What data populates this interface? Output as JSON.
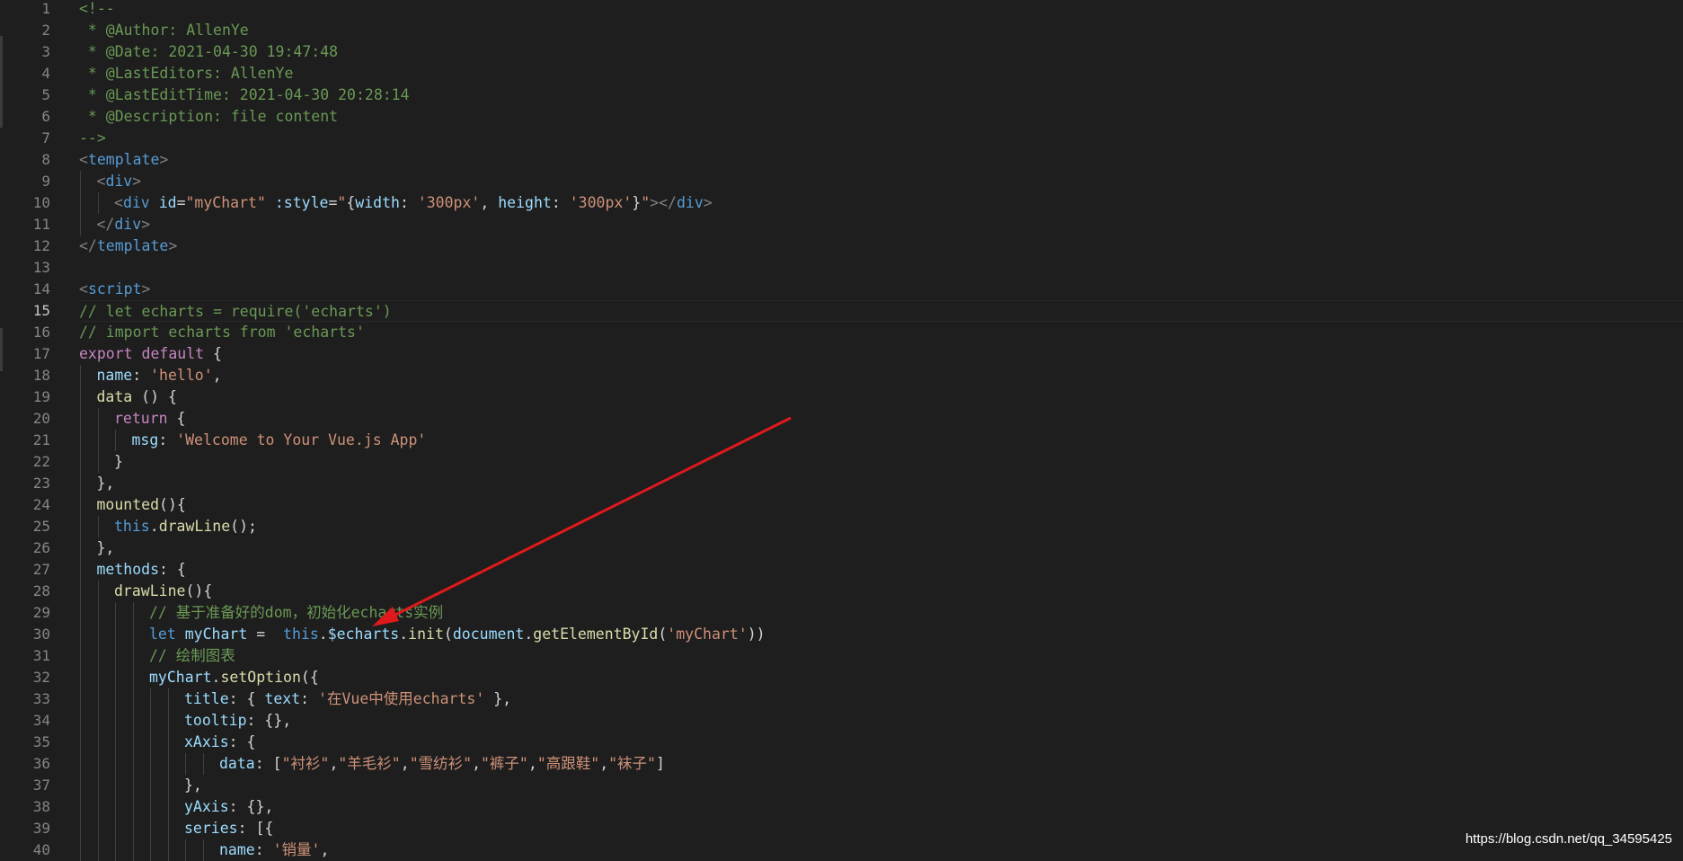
{
  "editor": {
    "active_line": 15,
    "colors": {
      "background": "#1e1e1e",
      "line_number": "#858585",
      "comment": "#6a9955",
      "tag": "#569cd6",
      "attribute": "#9cdcfe",
      "string": "#ce9178",
      "keyword": "#c586c0",
      "function": "#dcdcaa",
      "text": "#d4d4d4",
      "arrow": "#e0191b"
    },
    "lines": [
      {
        "n": "1",
        "indent": 0,
        "tokens": [
          {
            "t": "<!--",
            "c": "comment"
          }
        ]
      },
      {
        "n": "2",
        "indent": 0,
        "tokens": [
          {
            "t": " * @Author: AllenYe",
            "c": "comment"
          }
        ]
      },
      {
        "n": "3",
        "indent": 0,
        "tokens": [
          {
            "t": " * @Date: 2021-04-30 19:47:48",
            "c": "comment"
          }
        ]
      },
      {
        "n": "4",
        "indent": 0,
        "tokens": [
          {
            "t": " * @LastEditors: AllenYe",
            "c": "comment"
          }
        ]
      },
      {
        "n": "5",
        "indent": 0,
        "tokens": [
          {
            "t": " * @LastEditTime: 2021-04-30 20:28:14",
            "c": "comment"
          }
        ]
      },
      {
        "n": "6",
        "indent": 0,
        "tokens": [
          {
            "t": " * @Description: file content",
            "c": "comment"
          }
        ]
      },
      {
        "n": "7",
        "indent": 0,
        "tokens": [
          {
            "t": "-->",
            "c": "comment"
          }
        ]
      },
      {
        "n": "8",
        "indent": 0,
        "tokens": [
          {
            "t": "<",
            "c": "punct"
          },
          {
            "t": "template",
            "c": "tag"
          },
          {
            "t": ">",
            "c": "punct"
          }
        ]
      },
      {
        "n": "9",
        "indent": 1,
        "tokens": [
          {
            "t": "<",
            "c": "punct"
          },
          {
            "t": "div",
            "c": "tag"
          },
          {
            "t": ">",
            "c": "punct"
          }
        ]
      },
      {
        "n": "10",
        "indent": 2,
        "tokens": [
          {
            "t": "<",
            "c": "punct"
          },
          {
            "t": "div",
            "c": "tag"
          },
          {
            "t": " ",
            "c": "plain"
          },
          {
            "t": "id",
            "c": "attr"
          },
          {
            "t": "=",
            "c": "plain"
          },
          {
            "t": "\"myChart\"",
            "c": "string"
          },
          {
            "t": " ",
            "c": "plain"
          },
          {
            "t": ":style",
            "c": "attr"
          },
          {
            "t": "=",
            "c": "plain"
          },
          {
            "t": "\"",
            "c": "string"
          },
          {
            "t": "{",
            "c": "plain"
          },
          {
            "t": "width",
            "c": "prop"
          },
          {
            "t": ": ",
            "c": "plain"
          },
          {
            "t": "'300px'",
            "c": "string"
          },
          {
            "t": ", ",
            "c": "plain"
          },
          {
            "t": "height",
            "c": "prop"
          },
          {
            "t": ": ",
            "c": "plain"
          },
          {
            "t": "'300px'",
            "c": "string"
          },
          {
            "t": "}",
            "c": "plain"
          },
          {
            "t": "\"",
            "c": "string"
          },
          {
            "t": "></",
            "c": "punct"
          },
          {
            "t": "div",
            "c": "tag"
          },
          {
            "t": ">",
            "c": "punct"
          }
        ]
      },
      {
        "n": "11",
        "indent": 1,
        "tokens": [
          {
            "t": "</",
            "c": "punct"
          },
          {
            "t": "div",
            "c": "tag"
          },
          {
            "t": ">",
            "c": "punct"
          }
        ]
      },
      {
        "n": "12",
        "indent": 0,
        "tokens": [
          {
            "t": "</",
            "c": "punct"
          },
          {
            "t": "template",
            "c": "tag"
          },
          {
            "t": ">",
            "c": "punct"
          }
        ]
      },
      {
        "n": "13",
        "indent": 0,
        "tokens": []
      },
      {
        "n": "14",
        "indent": 0,
        "tokens": [
          {
            "t": "<",
            "c": "punct"
          },
          {
            "t": "script",
            "c": "tag"
          },
          {
            "t": ">",
            "c": "punct"
          }
        ]
      },
      {
        "n": "15",
        "indent": 0,
        "tokens": [
          {
            "t": "// let echarts = require('echarts')",
            "c": "comment"
          }
        ]
      },
      {
        "n": "16",
        "indent": 0,
        "tokens": [
          {
            "t": "// import echarts from 'echarts'",
            "c": "comment"
          }
        ]
      },
      {
        "n": "17",
        "indent": 0,
        "tokens": [
          {
            "t": "export",
            "c": "keyword"
          },
          {
            "t": " ",
            "c": "plain"
          },
          {
            "t": "default",
            "c": "keyword"
          },
          {
            "t": " {",
            "c": "plain"
          }
        ]
      },
      {
        "n": "18",
        "indent": 1,
        "tokens": [
          {
            "t": "name",
            "c": "prop"
          },
          {
            "t": ": ",
            "c": "plain"
          },
          {
            "t": "'hello'",
            "c": "string"
          },
          {
            "t": ",",
            "c": "plain"
          }
        ]
      },
      {
        "n": "19",
        "indent": 1,
        "tokens": [
          {
            "t": "data",
            "c": "func"
          },
          {
            "t": " () {",
            "c": "plain"
          }
        ]
      },
      {
        "n": "20",
        "indent": 2,
        "tokens": [
          {
            "t": "return",
            "c": "keyword"
          },
          {
            "t": " {",
            "c": "plain"
          }
        ]
      },
      {
        "n": "21",
        "indent": 3,
        "tokens": [
          {
            "t": "msg",
            "c": "prop"
          },
          {
            "t": ": ",
            "c": "plain"
          },
          {
            "t": "'Welcome to Your Vue.js App'",
            "c": "string"
          }
        ]
      },
      {
        "n": "22",
        "indent": 2,
        "tokens": [
          {
            "t": "}",
            "c": "plain"
          }
        ]
      },
      {
        "n": "23",
        "indent": 1,
        "tokens": [
          {
            "t": "},",
            "c": "plain"
          }
        ]
      },
      {
        "n": "24",
        "indent": 1,
        "tokens": [
          {
            "t": "mounted",
            "c": "func"
          },
          {
            "t": "(){",
            "c": "plain"
          }
        ]
      },
      {
        "n": "25",
        "indent": 2,
        "tokens": [
          {
            "t": "this",
            "c": "this"
          },
          {
            "t": ".",
            "c": "plain"
          },
          {
            "t": "drawLine",
            "c": "func"
          },
          {
            "t": "();",
            "c": "plain"
          }
        ]
      },
      {
        "n": "26",
        "indent": 1,
        "tokens": [
          {
            "t": "},",
            "c": "plain"
          }
        ]
      },
      {
        "n": "27",
        "indent": 1,
        "tokens": [
          {
            "t": "methods",
            "c": "prop"
          },
          {
            "t": ": {",
            "c": "plain"
          }
        ]
      },
      {
        "n": "28",
        "indent": 2,
        "tokens": [
          {
            "t": "drawLine",
            "c": "func"
          },
          {
            "t": "(){",
            "c": "plain"
          }
        ]
      },
      {
        "n": "29",
        "indent": 4,
        "tokens": [
          {
            "t": "// 基于准备好的dom，初始化echarts实例",
            "c": "comment"
          }
        ]
      },
      {
        "n": "30",
        "indent": 4,
        "tokens": [
          {
            "t": "let",
            "c": "blue"
          },
          {
            "t": " ",
            "c": "plain"
          },
          {
            "t": "myChart",
            "c": "var"
          },
          {
            "t": " =  ",
            "c": "plain"
          },
          {
            "t": "this",
            "c": "this"
          },
          {
            "t": ".",
            "c": "plain"
          },
          {
            "t": "$echarts",
            "c": "var"
          },
          {
            "t": ".",
            "c": "plain"
          },
          {
            "t": "init",
            "c": "func"
          },
          {
            "t": "(",
            "c": "plain"
          },
          {
            "t": "document",
            "c": "var"
          },
          {
            "t": ".",
            "c": "plain"
          },
          {
            "t": "getElementById",
            "c": "func"
          },
          {
            "t": "(",
            "c": "plain"
          },
          {
            "t": "'myChart'",
            "c": "string"
          },
          {
            "t": "))",
            "c": "plain"
          }
        ]
      },
      {
        "n": "31",
        "indent": 4,
        "tokens": [
          {
            "t": "// 绘制图表",
            "c": "comment"
          }
        ]
      },
      {
        "n": "32",
        "indent": 4,
        "tokens": [
          {
            "t": "myChart",
            "c": "var"
          },
          {
            "t": ".",
            "c": "plain"
          },
          {
            "t": "setOption",
            "c": "func"
          },
          {
            "t": "({",
            "c": "plain"
          }
        ]
      },
      {
        "n": "33",
        "indent": 6,
        "tokens": [
          {
            "t": "title",
            "c": "prop"
          },
          {
            "t": ": { ",
            "c": "plain"
          },
          {
            "t": "text",
            "c": "prop"
          },
          {
            "t": ": ",
            "c": "plain"
          },
          {
            "t": "'在Vue中使用echarts'",
            "c": "string"
          },
          {
            "t": " },",
            "c": "plain"
          }
        ]
      },
      {
        "n": "34",
        "indent": 6,
        "tokens": [
          {
            "t": "tooltip",
            "c": "prop"
          },
          {
            "t": ": {},",
            "c": "plain"
          }
        ]
      },
      {
        "n": "35",
        "indent": 6,
        "tokens": [
          {
            "t": "xAxis",
            "c": "prop"
          },
          {
            "t": ": {",
            "c": "plain"
          }
        ]
      },
      {
        "n": "36",
        "indent": 8,
        "tokens": [
          {
            "t": "data",
            "c": "prop"
          },
          {
            "t": ": [",
            "c": "plain"
          },
          {
            "t": "\"衬衫\"",
            "c": "string"
          },
          {
            "t": ",",
            "c": "plain"
          },
          {
            "t": "\"羊毛衫\"",
            "c": "string"
          },
          {
            "t": ",",
            "c": "plain"
          },
          {
            "t": "\"雪纺衫\"",
            "c": "string"
          },
          {
            "t": ",",
            "c": "plain"
          },
          {
            "t": "\"裤子\"",
            "c": "string"
          },
          {
            "t": ",",
            "c": "plain"
          },
          {
            "t": "\"高跟鞋\"",
            "c": "string"
          },
          {
            "t": ",",
            "c": "plain"
          },
          {
            "t": "\"袜子\"",
            "c": "string"
          },
          {
            "t": "]",
            "c": "plain"
          }
        ]
      },
      {
        "n": "37",
        "indent": 6,
        "tokens": [
          {
            "t": "},",
            "c": "plain"
          }
        ]
      },
      {
        "n": "38",
        "indent": 6,
        "tokens": [
          {
            "t": "yAxis",
            "c": "prop"
          },
          {
            "t": ": {},",
            "c": "plain"
          }
        ]
      },
      {
        "n": "39",
        "indent": 6,
        "tokens": [
          {
            "t": "series",
            "c": "prop"
          },
          {
            "t": ": [{",
            "c": "plain"
          }
        ]
      },
      {
        "n": "40",
        "indent": 8,
        "tokens": [
          {
            "t": "name",
            "c": "prop"
          },
          {
            "t": ": ",
            "c": "plain"
          },
          {
            "t": "'销量'",
            "c": "string"
          },
          {
            "t": ",",
            "c": "plain"
          }
        ]
      }
    ]
  },
  "watermark": {
    "text": "https://blog.csdn.net/qq_34595425"
  }
}
